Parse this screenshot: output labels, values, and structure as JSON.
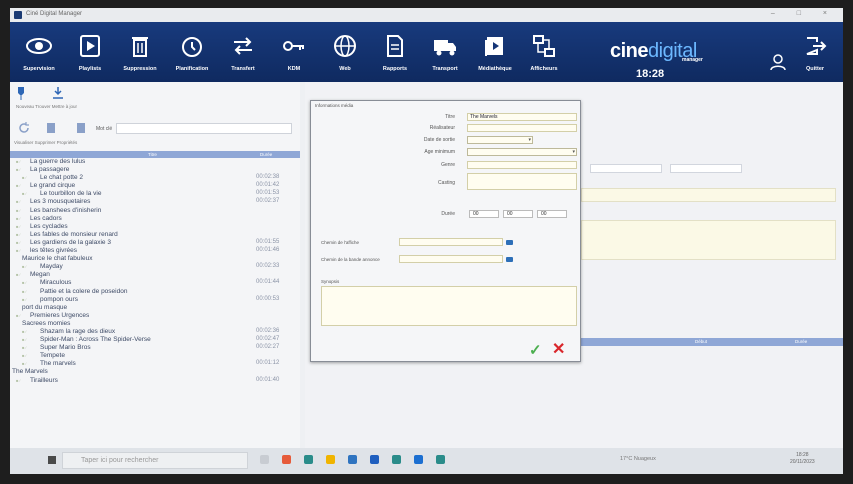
{
  "window": {
    "title": "Ciné Digital Manager",
    "controls": "– □ ×"
  },
  "toolbar": {
    "items": [
      {
        "label": "Supervision",
        "icon": "eye-icon"
      },
      {
        "label": "Playlists",
        "icon": "play-icon"
      },
      {
        "label": "Suppression",
        "icon": "trash-icon"
      },
      {
        "label": "Planification",
        "icon": "clock-icon"
      },
      {
        "label": "Transfert",
        "icon": "transfer-icon"
      },
      {
        "label": "KDM",
        "icon": "key-icon"
      },
      {
        "label": "Web",
        "icon": "globe-icon"
      },
      {
        "label": "Rapports",
        "icon": "report-icon"
      },
      {
        "label": "Transport",
        "icon": "truck-icon"
      },
      {
        "label": "Médiathèque",
        "icon": "media-icon"
      },
      {
        "label": "Afficheurs",
        "icon": "network-icon"
      }
    ],
    "logo_main": "cine",
    "logo_accent": "digital",
    "logo_sub": "manager",
    "clock": "18:28",
    "quit_label": "Quitter"
  },
  "left": {
    "smallbar_label": "Nouveau  Trouver  Mettre à jour",
    "search_label": "Mot clé",
    "search_value": "",
    "sub_tools": "Visualiser  Supprimer  Propriétés",
    "col_title": "Titre",
    "col_duration": "Durée",
    "tree": [
      {
        "indent": 0,
        "title": "La guerre des lulus",
        "duration": ""
      },
      {
        "indent": 0,
        "title": "La passagere",
        "duration": ""
      },
      {
        "indent": 1,
        "title": "Le chat potte 2",
        "duration": "00:02:38"
      },
      {
        "indent": 0,
        "title": "Le grand cirque",
        "duration": "00:01:42"
      },
      {
        "indent": 1,
        "title": "Le tourbillon de la vie",
        "duration": "00:01:53"
      },
      {
        "indent": 0,
        "title": "Les 3 mousquetaires",
        "duration": "00:02:37"
      },
      {
        "indent": 0,
        "title": "Les banshees d'inisherin",
        "duration": ""
      },
      {
        "indent": 0,
        "title": "Les cadors",
        "duration": ""
      },
      {
        "indent": 0,
        "title": "Les cyclades",
        "duration": ""
      },
      {
        "indent": 0,
        "title": "Les fables de monsieur renard",
        "duration": ""
      },
      {
        "indent": 0,
        "title": "Les gardiens de la galaxie 3",
        "duration": "00:01:55"
      },
      {
        "indent": 0,
        "title": "les têtes givrées",
        "duration": "00:01:46"
      },
      {
        "indent": -1,
        "title": "Maurice le chat fabuleux",
        "duration": ""
      },
      {
        "indent": 1,
        "title": "Mayday",
        "duration": "00:02:33"
      },
      {
        "indent": 0,
        "title": "Megan",
        "duration": ""
      },
      {
        "indent": 1,
        "title": "Miraculous",
        "duration": "00:01:44"
      },
      {
        "indent": 1,
        "title": "Pattie et la colere de poseidon",
        "duration": ""
      },
      {
        "indent": 1,
        "title": "pompon ours",
        "duration": "00:00:53"
      },
      {
        "indent": -1,
        "title": "port du masque",
        "duration": ""
      },
      {
        "indent": 0,
        "title": "Premieres Urgences",
        "duration": ""
      },
      {
        "indent": -1,
        "title": "Sacrees momies",
        "duration": ""
      },
      {
        "indent": 1,
        "title": "Shazam la rage des dieux",
        "duration": "00:02:36"
      },
      {
        "indent": 1,
        "title": "Spider-Man : Across The Spider-Verse",
        "duration": "00:02:47"
      },
      {
        "indent": 1,
        "title": "Super Mario Bros",
        "duration": "00:02:27"
      },
      {
        "indent": 1,
        "title": "Tempete",
        "duration": ""
      },
      {
        "indent": 1,
        "title": "The marvels",
        "duration": "00:01:12"
      },
      {
        "indent": -2,
        "title": "The Marvels",
        "duration": ""
      },
      {
        "indent": 0,
        "title": "Tirailleurs",
        "duration": "00:01:40"
      }
    ]
  },
  "dialog": {
    "title": "Informations média",
    "fields": {
      "titre_label": "Titre",
      "titre_value": "The Marvels",
      "realisateur_label": "Réalisateur",
      "date_label": "Date de sortie",
      "age_label": "Age minimum",
      "genre_label": "Genre",
      "casting_label": "Casting",
      "duree_label": "Durée",
      "duree_h": "00",
      "duree_m": "00",
      "duree_s": "00"
    },
    "affiche_label": "Chemin de l'affiche",
    "bande_label": "Chemin de la bande annonce",
    "synopsis_label": "Synopsis",
    "ok_label": "✓",
    "cancel_label": "✕"
  },
  "right": {
    "col_a": "Début",
    "col_b": "Durée"
  },
  "taskbar": {
    "search_placeholder": "Taper ici pour rechercher",
    "weather": "17°C  Nuageux",
    "time": "18:28",
    "date": "20/11/2023"
  }
}
